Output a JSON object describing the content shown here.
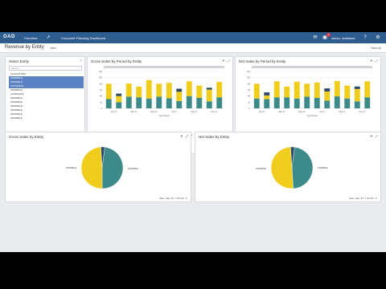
{
  "topbar": {
    "logo": "OAD",
    "nav_favorites": "Favorites",
    "nav_current": "Corporate Planning Dashboard",
    "user": "admin, database",
    "notif_count": "2",
    "help": "?"
  },
  "page": {
    "title": "Revenue by Entity",
    "view_label": "View",
    "save_label": "Save As"
  },
  "entity_panel": {
    "title": "Select Entity",
    "search_placeholder": "Search",
    "items": [
      {
        "label": "ALLENTITIES",
        "selected": false
      },
      {
        "label": "10000BILE",
        "selected": true
      },
      {
        "label": "20000BILE",
        "selected": true
      },
      {
        "label": "TOTALDETL",
        "selected": true
      },
      {
        "label": "30000BILE",
        "selected": false
      },
      {
        "label": "COMPLETE",
        "selected": false
      },
      {
        "label": "30000BILE",
        "selected": false
      },
      {
        "label": "20000BILE",
        "selected": false
      },
      {
        "label": "20000BILE",
        "selected": false
      },
      {
        "label": "20000BILE",
        "selected": false
      },
      {
        "label": "20000BILE",
        "selected": false
      },
      {
        "label": "20000BILE",
        "selected": false
      }
    ]
  },
  "colors": {
    "teal": "#3c8a8a",
    "yellow": "#f0cd1d",
    "navy": "#2b4a66",
    "gray": "#9aa3ad"
  },
  "legend": [
    {
      "label": "10000BILE",
      "color": "#3c8a8a"
    },
    {
      "label": "20000BILE",
      "color": "#f0cd1d"
    },
    {
      "label": "20000BILE",
      "color": "#2b4a66"
    },
    {
      "label": "20000BILE",
      "color": "#555555"
    },
    {
      "label": "30000BILE",
      "color": "#a0522d"
    },
    {
      "label": "20000BILE",
      "color": "#6b8e23"
    },
    {
      "label": "20000BILE",
      "color": "#8a6bb0"
    },
    {
      "label": "TOTALDETL",
      "color": "#4682b4"
    },
    {
      "label": "20000BILE",
      "color": "#d4e04a"
    }
  ],
  "timestamp": "Wed, May 23, 7:30 AM",
  "chart_data": [
    {
      "type": "bar",
      "title": "Gross Sales by Period by Entity",
      "categories": [
        "Jan-17",
        "Feb-17",
        "Mar-17",
        "Apr-17",
        "May-17",
        "Jun-17",
        "Jul-17",
        "Aug-17",
        "Sep-17",
        "Oct-17",
        "Nov-17",
        "Dec-17"
      ],
      "tick_labels": [
        "Jan-17",
        "Mar-17",
        "May-17",
        "Jul-17",
        "Sep-17",
        "Nov-17"
      ],
      "xlabel": "Year Period",
      "ylim": [
        0,
        120
      ],
      "yticks": [
        "0",
        "20",
        "40",
        "60",
        "80",
        "100",
        "120"
      ],
      "series": [
        {
          "name": "10000BILE",
          "values": [
            30,
            20,
            38,
            36,
            32,
            38,
            33,
            24,
            40,
            34,
            23,
            36
          ]
        },
        {
          "name": "20000BILE",
          "values": [
            50,
            20,
            43,
            35,
            60,
            42,
            50,
            30,
            48,
            40,
            38,
            50
          ]
        },
        {
          "name": "20000BILE",
          "values": [
            0,
            8,
            0,
            0,
            0,
            0,
            0,
            10,
            0,
            0,
            6,
            0
          ]
        }
      ]
    },
    {
      "type": "bar",
      "title": "Net Sales by Period by Entity",
      "categories": [
        "Jan-17",
        "Feb-17",
        "Mar-17",
        "Apr-17",
        "May-17",
        "Jun-17",
        "Jul-17",
        "Aug-17",
        "Sep-17",
        "Oct-17",
        "Nov-17",
        "Dec-17"
      ],
      "tick_labels": [
        "Jan-17",
        "Mar-17",
        "May-17",
        "Jul-17",
        "Sep-17",
        "Nov-17"
      ],
      "xlabel": "Year Period",
      "ylim": [
        0,
        120
      ],
      "yticks": [
        "0",
        "20",
        "40",
        "60",
        "80",
        "100",
        "120"
      ],
      "series": [
        {
          "name": "10000BILE",
          "values": [
            32,
            30,
            36,
            36,
            32,
            38,
            34,
            25,
            39,
            32,
            23,
            36
          ]
        },
        {
          "name": "20000BILE",
          "values": [
            48,
            12,
            52,
            35,
            55,
            42,
            50,
            30,
            50,
            42,
            40,
            52
          ]
        },
        {
          "name": "20000BILE",
          "values": [
            0,
            10,
            0,
            0,
            0,
            0,
            0,
            10,
            0,
            0,
            8,
            0
          ]
        }
      ]
    },
    {
      "type": "pie",
      "title": "Gross Sales by Entity",
      "slices": [
        {
          "label": "10000BILE",
          "value": 48
        },
        {
          "label": "20000BILE",
          "value": 49
        },
        {
          "label": "30000BILE",
          "value": 3
        }
      ]
    },
    {
      "type": "pie",
      "title": "Net Sales by Entity",
      "slices": [
        {
          "label": "10000BILE",
          "value": 47
        },
        {
          "label": "20000BILE",
          "value": 50
        },
        {
          "label": "30000BILE",
          "value": 3
        }
      ]
    }
  ]
}
